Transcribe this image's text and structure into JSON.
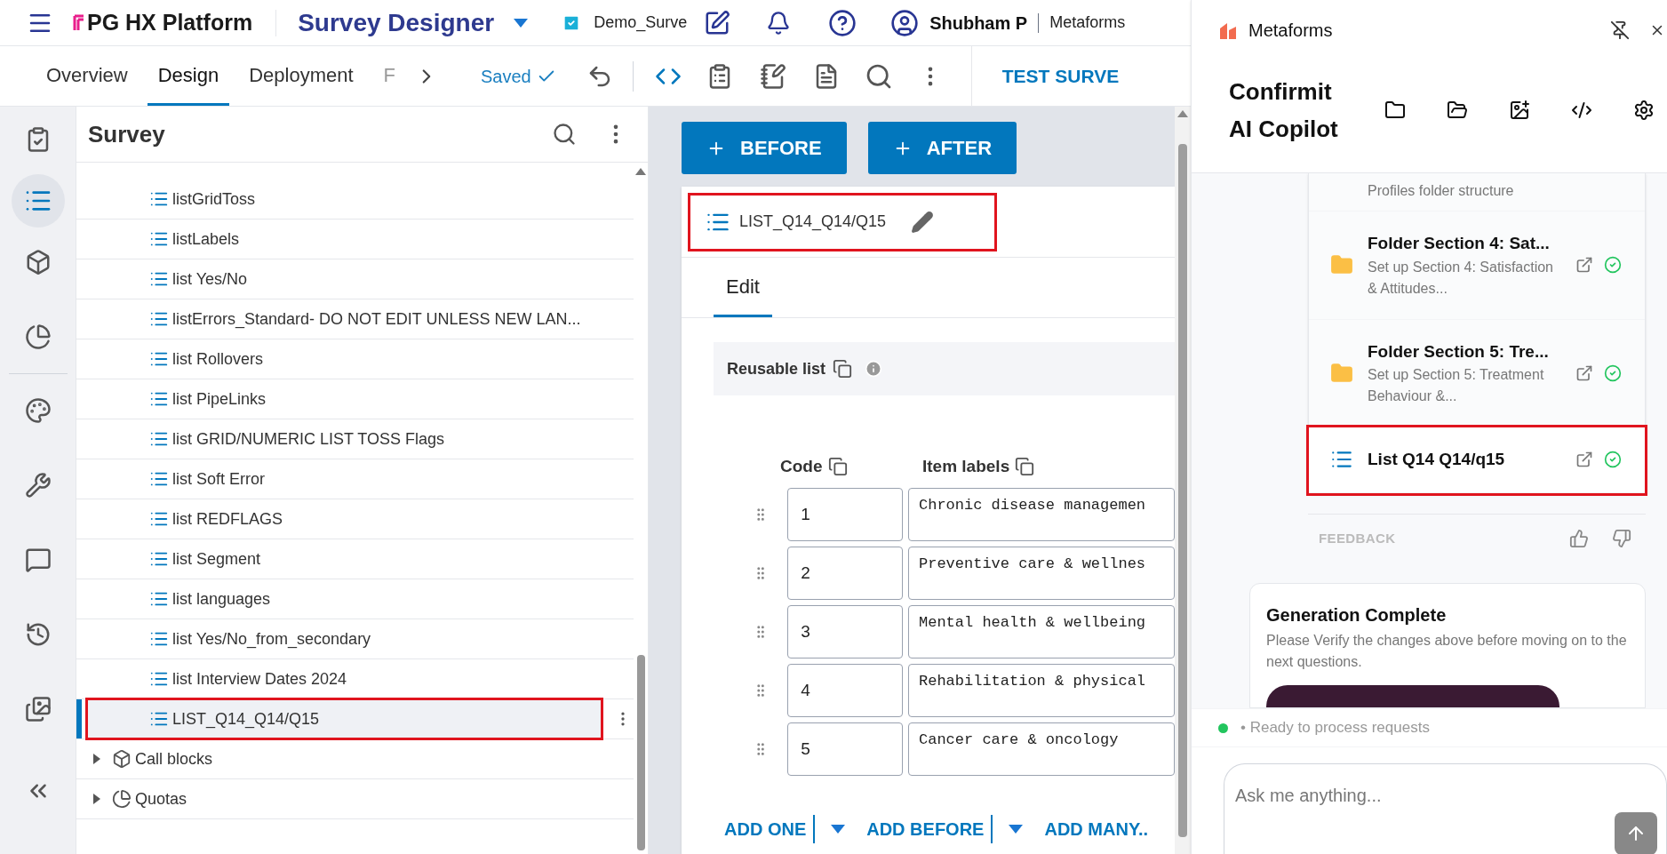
{
  "top_bar": {
    "logo": "PG HX Platform",
    "app_title": "Survey Designer",
    "survey_name": "Demo_Surve",
    "user_name": "Shubham P",
    "org": "Metaforms"
  },
  "nav_tabs": [
    {
      "label": "Overview",
      "selected": false,
      "faded": false
    },
    {
      "label": "Design",
      "selected": true,
      "faded": false
    },
    {
      "label": "Deployment",
      "selected": false,
      "faded": false
    },
    {
      "label": "F",
      "selected": false,
      "faded": true
    }
  ],
  "save_status": "Saved",
  "test_button": "TEST SURVE",
  "tree": {
    "title": "Survey",
    "items": [
      {
        "kind": "list",
        "label": "listGridToss",
        "selected": false,
        "highlighted": false
      },
      {
        "kind": "list",
        "label": "listLabels",
        "selected": false,
        "highlighted": false
      },
      {
        "kind": "list",
        "label": "list Yes/No",
        "selected": false,
        "highlighted": false
      },
      {
        "kind": "list",
        "label": "listErrors_Standard- DO NOT EDIT UNLESS NEW LAN...",
        "selected": false,
        "highlighted": false
      },
      {
        "kind": "list",
        "label": "list Rollovers",
        "selected": false,
        "highlighted": false
      },
      {
        "kind": "list",
        "label": "list PipeLinks",
        "selected": false,
        "highlighted": false
      },
      {
        "kind": "list",
        "label": "list GRID/NUMERIC LIST TOSS Flags",
        "selected": false,
        "highlighted": false
      },
      {
        "kind": "list",
        "label": "list Soft Error",
        "selected": false,
        "highlighted": false
      },
      {
        "kind": "list",
        "label": "list REDFLAGS",
        "selected": false,
        "highlighted": false
      },
      {
        "kind": "list",
        "label": "list Segment",
        "selected": false,
        "highlighted": false
      },
      {
        "kind": "list",
        "label": "list languages",
        "selected": false,
        "highlighted": false
      },
      {
        "kind": "list",
        "label": "list Yes/No_from_secondary",
        "selected": false,
        "highlighted": false
      },
      {
        "kind": "list",
        "label": "list Interview Dates 2024",
        "selected": false,
        "highlighted": false
      },
      {
        "kind": "list",
        "label": "LIST_Q14_Q14/Q15",
        "selected": true,
        "highlighted": true
      },
      {
        "kind": "block",
        "label": "Call blocks",
        "selected": false,
        "highlighted": false,
        "expanded": false
      },
      {
        "kind": "quota",
        "label": "Quotas",
        "selected": false,
        "highlighted": false,
        "expanded": false
      }
    ]
  },
  "insert_buttons": [
    "BEFORE",
    "AFTER"
  ],
  "list_card": {
    "title": "LIST_Q14_Q14/Q15",
    "highlighted": true,
    "tabs": [
      {
        "label": "Edit",
        "selected": true
      }
    ],
    "section_label": "Reusable list",
    "columns": [
      "Code",
      "Item labels"
    ],
    "rows": [
      {
        "code": "1",
        "label": "Chronic disease managemen"
      },
      {
        "code": "2",
        "label": "Preventive care & wellnes"
      },
      {
        "code": "3",
        "label": "Mental health & wellbeing"
      },
      {
        "code": "4",
        "label": "Rehabilitation & physical"
      },
      {
        "code": "5",
        "label": "Cancer care & oncology"
      }
    ],
    "actions": [
      "ADD ONE",
      "ADD BEFORE",
      "ADD MANY.."
    ]
  },
  "copilot": {
    "brand": "Metaforms",
    "title": "Confirmit AI Copilot",
    "items": [
      {
        "kind": "folder",
        "description": "Profiles folder structure",
        "done": false,
        "highlighted": false
      },
      {
        "kind": "folder",
        "title": "Folder Section 4: Sat...",
        "description": "Set up Section 4: Satisfaction & Attitudes...",
        "done": true,
        "highlighted": false
      },
      {
        "kind": "folder",
        "title": "Folder Section 5: Tre...",
        "description": "Set up Section 5: Treatment Behaviour &...",
        "done": true,
        "highlighted": false
      },
      {
        "kind": "list",
        "title": "List Q14 Q14/q15",
        "done": true,
        "highlighted": true
      }
    ],
    "feedback_label": "FEEDBACK",
    "generation": {
      "title": "Generation Complete",
      "text": "Please Verify the changes above before moving on to the next questions."
    },
    "status": {
      "text": "• Ready to process requests",
      "online": true
    },
    "input": {
      "placeholder": "Ask me anything..."
    }
  }
}
